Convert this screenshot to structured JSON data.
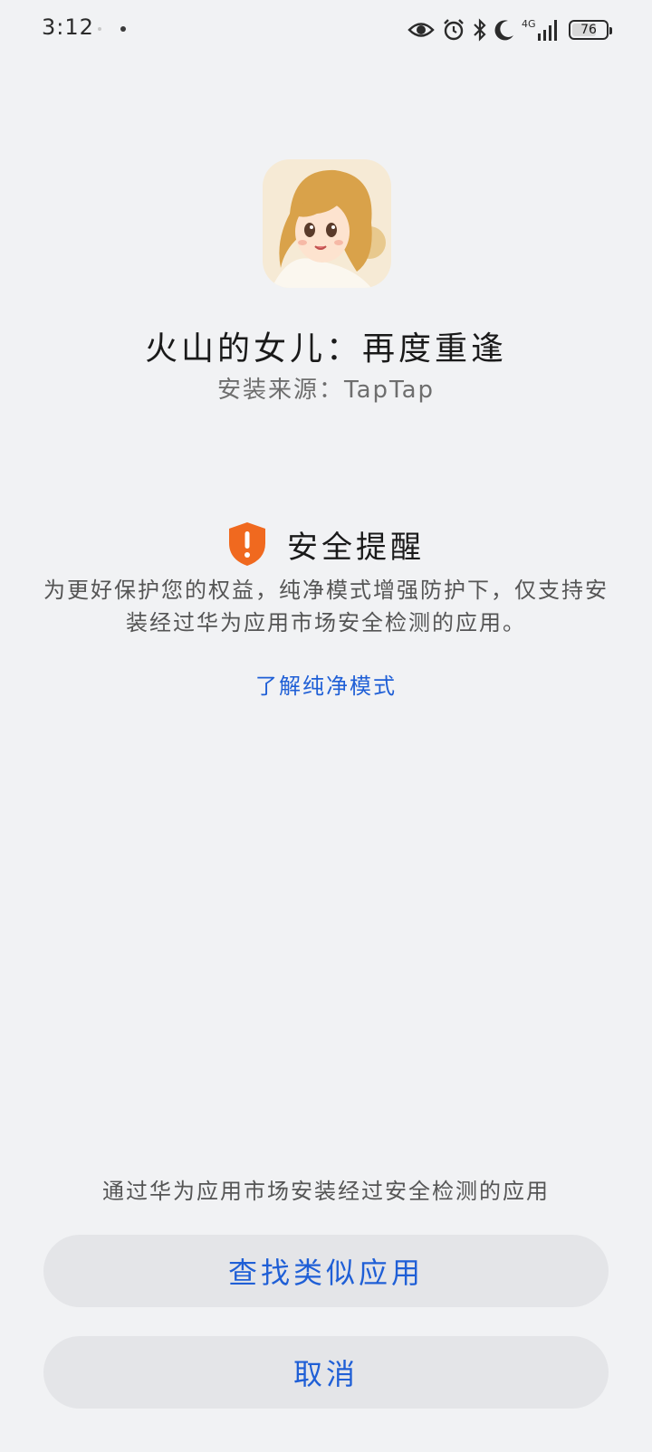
{
  "status_bar": {
    "time": "3:12",
    "network": "4G",
    "battery": "76",
    "battery_level": 0.76,
    "icons": [
      "eye-icon",
      "alarm-icon",
      "bluetooth-icon",
      "moon-icon",
      "signal-icon",
      "battery-icon"
    ]
  },
  "app": {
    "icon": "app-icon-anime-girl",
    "name": "火山的女儿：再度重逢",
    "source": "安装来源：TapTap"
  },
  "notice": {
    "icon": "shield-warning-icon",
    "title": "安全提醒",
    "body": "为更好保护您的权益，纯净模式增强防护下，仅支持安装经过华为应用市场安全检测的应用。",
    "link": "了解纯净模式"
  },
  "footer": {
    "hint": "通过华为应用市场安装经过安全检测的应用",
    "find_button": "查找类似应用",
    "cancel_button": "取消"
  },
  "colors": {
    "background": "#f1f2f4",
    "accent": "#1f5fd6",
    "warning": "#f0691f",
    "button_bg": "#e4e5e8"
  }
}
